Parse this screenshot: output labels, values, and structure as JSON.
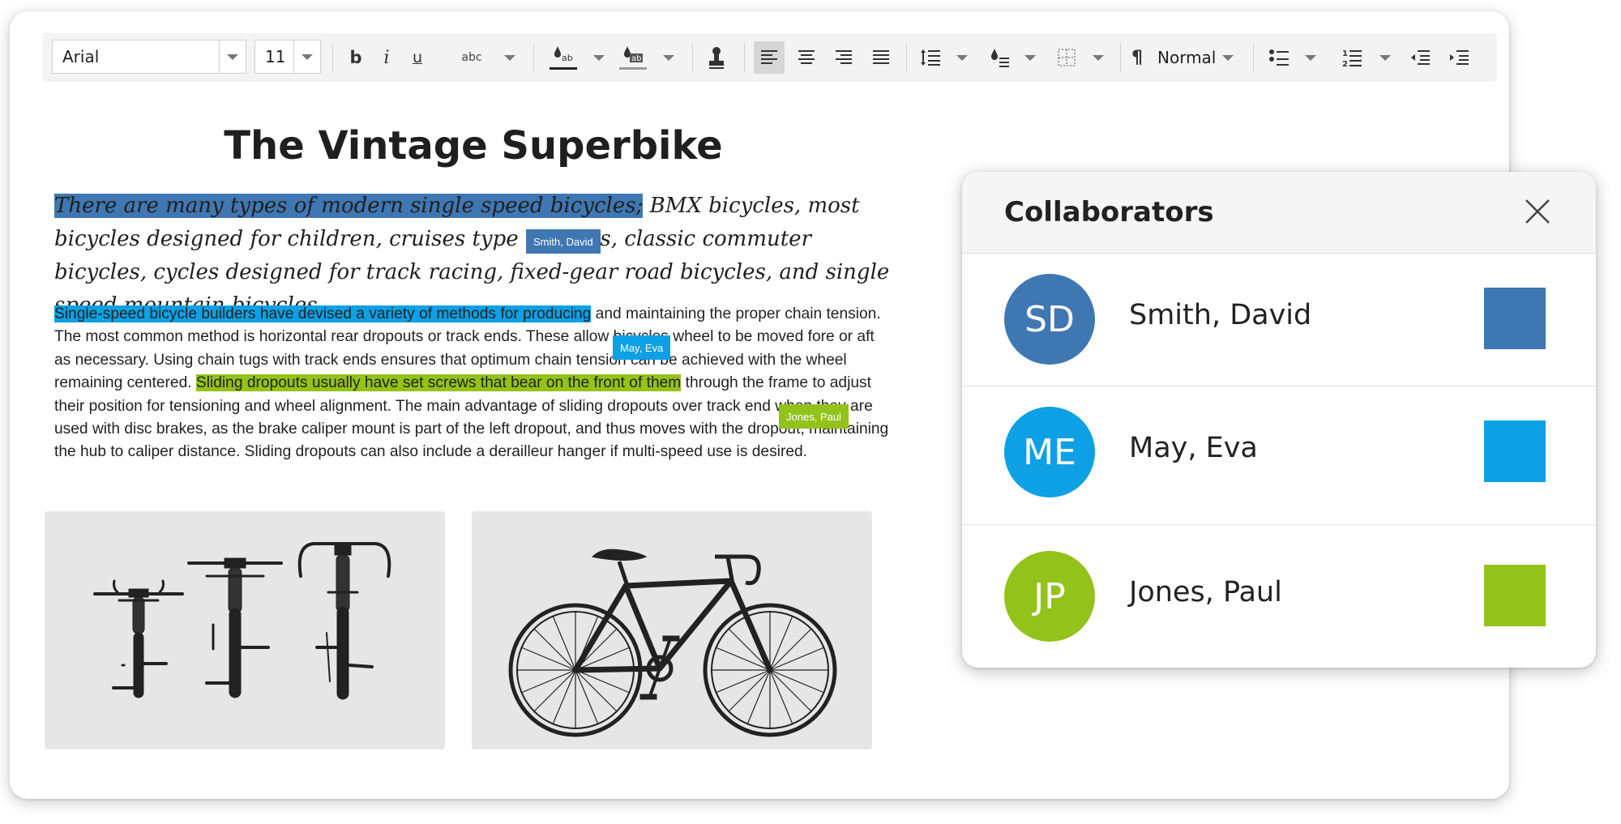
{
  "toolbar": {
    "font_family": "Arial",
    "font_size": "11",
    "strikethrough_glyph": "abc",
    "paragraph_style": "Normal",
    "colors": {
      "active_bg": "#d6d6d6",
      "toolbar_bg": "#f3f3f3"
    }
  },
  "document": {
    "title": "The Vintage Superbike",
    "script_para": {
      "highlight": "There are many types of modern single speed bicycles;",
      "rest": " BMX bicycles, most bicycles designed for children, cruises type bicycles, classic commuter bicycles, cycles designed for track racing, fixed-gear road bicycles, and single speed mountain bicycles."
    },
    "body_para": {
      "hl1": "Single-speed bicycle builders have devised a variety of methods for producing",
      "t1": " and maintaining the proper chain tension. The most common method is horizontal rear dropouts or track ends. These allow bicycles wheel to be moved fore or aft as necessary. Using chain tugs with track ends ensures that optimum chain tension can be achieved with the wheel remaining centered. ",
      "hl2": "Sliding dropouts usually have set screws that bear on the front of them",
      "t2": " through the frame to adjust their position for tensioning and wheel alignment. The main advantage of sliding dropouts over track end when they are used with disc brakes, as the brake caliper mount is part of the left dropout, and thus moves with the dropout, maintaining the hub to caliper distance. Sliding dropouts can also include a derailleur hanger if multi-speed use is desired."
    },
    "tags": {
      "smith": "Smith, David",
      "may": "May, Eva",
      "jones": "Jones, Paul"
    }
  },
  "collaborators": {
    "title": "Collaborators",
    "items": [
      {
        "initials": "SD",
        "name": "Smith, David",
        "color": "#3f77b2"
      },
      {
        "initials": "ME",
        "name": "May, Eva",
        "color": "#0da0e4"
      },
      {
        "initials": "JP",
        "name": "Jones, Paul",
        "color": "#93c21a"
      }
    ]
  }
}
